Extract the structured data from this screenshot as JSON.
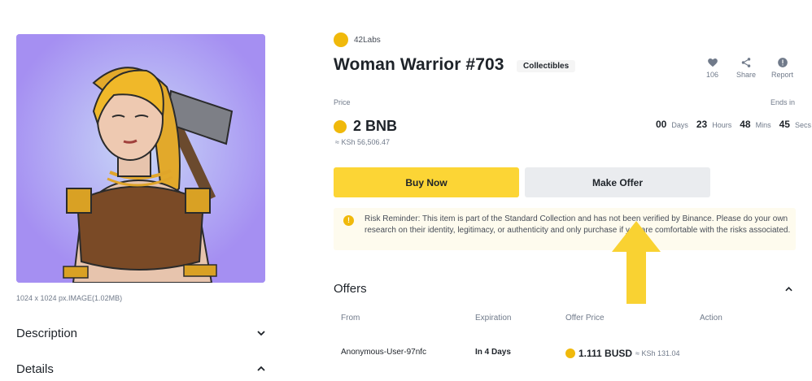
{
  "colors": {
    "accent": "#fcd535",
    "coin": "#f0b90b",
    "image_bg": "#a58ff2",
    "arrow": "#f9d232"
  },
  "nft": {
    "image_meta": "1024 x 1024 px.IMAGE(1.02MB)",
    "creator": "42Labs",
    "title": "Woman Warrior #703",
    "collection_tag": "Collectibles"
  },
  "sections": {
    "description": "Description",
    "details": "Details"
  },
  "stats": {
    "likes": "106",
    "share": "Share",
    "report": "Report"
  },
  "price": {
    "label": "Price",
    "value": "2 BNB",
    "fiat": "≈ KSh 56,506.47",
    "ends_label": "Ends in"
  },
  "countdown": {
    "days": "00",
    "days_unit": "Days",
    "hours": "23",
    "hours_unit": "Hours",
    "mins": "48",
    "mins_unit": "Mins",
    "secs": "45",
    "secs_unit": "Secs"
  },
  "buttons": {
    "buy": "Buy Now",
    "offer": "Make Offer"
  },
  "risk": {
    "text": "Risk Reminder: This item is part of the Standard Collection and has not been verified by Binance. Please do your own research on their identity, legitimacy, or authenticity and only purchase if you are comfortable with the risks associated."
  },
  "offers": {
    "title": "Offers",
    "columns": [
      "From",
      "Expiration",
      "Offer Price",
      "Action"
    ],
    "rows": [
      {
        "from": "Anonymous-User-97nfc",
        "expiration": "In 4 Days",
        "amount": "1.111 BUSD",
        "fiat": "≈ KSh 131.04"
      }
    ]
  },
  "icons": [
    "heart-icon",
    "share-icon",
    "report-icon",
    "chevron-down-icon",
    "chevron-up-icon",
    "warning-icon",
    "bnb-coin-icon",
    "busd-coin-icon"
  ]
}
